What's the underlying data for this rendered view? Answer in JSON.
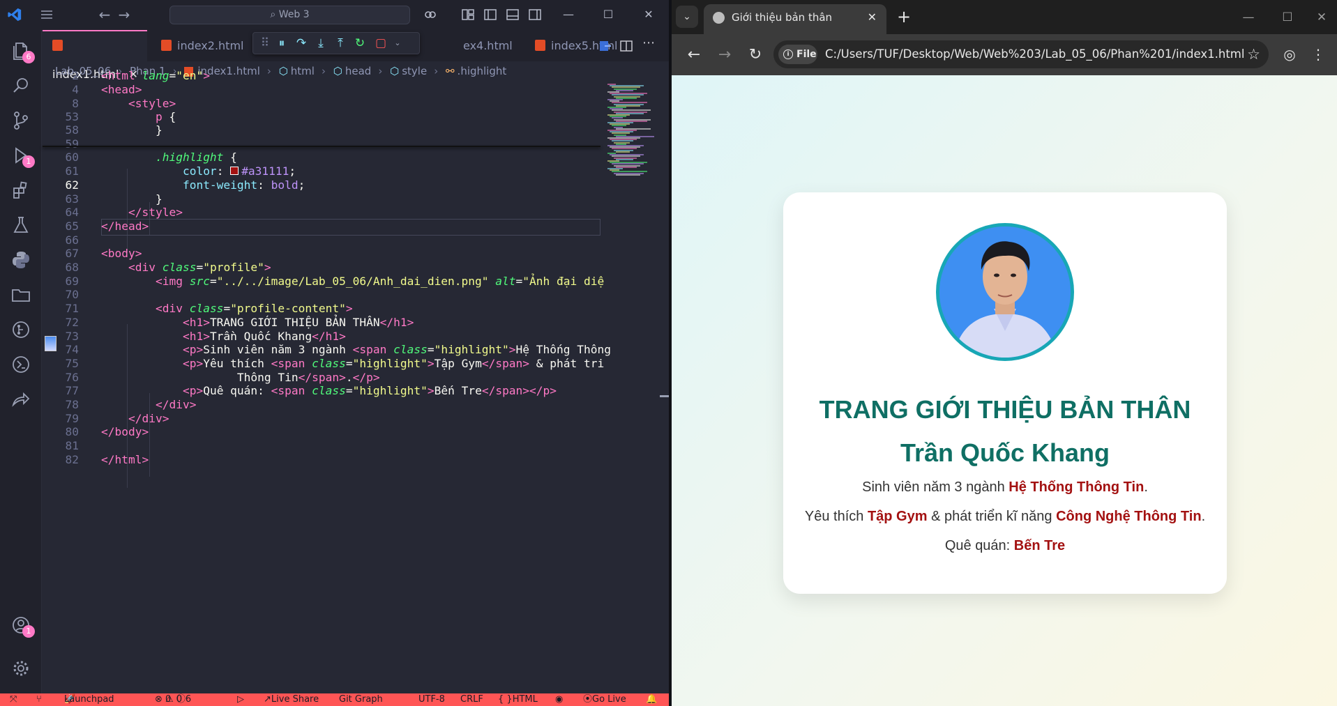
{
  "vscode": {
    "search_text": "Web 3",
    "tabs": [
      {
        "label": "index1.html",
        "active": true
      },
      {
        "label": "index2.html"
      },
      {
        "label": "ex4.html"
      },
      {
        "label": "index5.html"
      }
    ],
    "breadcrumb": [
      "Lab_05_06",
      "Phan 1",
      "index1.html",
      "html",
      "head",
      "style",
      ".highlight"
    ],
    "activity_badges": {
      "explorer": "6",
      "debug": "1",
      "account": "1"
    },
    "lines": [
      {
        "n": "2",
        "parts": [
          [
            "tagc",
            "<html "
          ],
          [
            "attr",
            "lang"
          ],
          [
            "pun",
            "="
          ],
          [
            "str",
            "\"en\""
          ],
          [
            "tagc",
            ">"
          ]
        ]
      },
      {
        "n": "4",
        "parts": [
          [
            "tagc",
            "<head>"
          ]
        ]
      },
      {
        "n": "8",
        "parts": [
          [
            "pun",
            "    "
          ],
          [
            "tagc",
            "<style>"
          ]
        ]
      },
      {
        "n": "53",
        "parts": [
          [
            "pun",
            "        "
          ],
          [
            "tagc",
            "p"
          ],
          [
            "pun",
            " {"
          ]
        ]
      },
      {
        "n": "58",
        "parts": [
          [
            "pun",
            "        }"
          ]
        ]
      },
      {
        "n": "59",
        "parts": [
          [
            "pun",
            ""
          ]
        ]
      },
      {
        "n": "60",
        "parts": [
          [
            "pun",
            "        "
          ],
          [
            "sel",
            ".highlight"
          ],
          [
            "pun",
            " {"
          ]
        ]
      },
      {
        "n": "61",
        "parts": [
          [
            "pun",
            "            "
          ],
          [
            "prop",
            "color"
          ],
          [
            "pun",
            ": "
          ],
          [
            "swatch",
            ""
          ],
          [
            "val",
            "#a31111"
          ],
          [
            "pun",
            ";"
          ]
        ]
      },
      {
        "n": "62",
        "parts": [
          [
            "pun",
            "            "
          ],
          [
            "prop",
            "font-weight"
          ],
          [
            "pun",
            ": "
          ],
          [
            "val",
            "bold"
          ],
          [
            "pun",
            ";"
          ]
        ]
      },
      {
        "n": "63",
        "parts": [
          [
            "pun",
            "        }"
          ]
        ]
      },
      {
        "n": "64",
        "parts": [
          [
            "pun",
            "    "
          ],
          [
            "tagc",
            "</style>"
          ]
        ]
      },
      {
        "n": "65",
        "parts": [
          [
            "tagc",
            "</head>"
          ]
        ]
      },
      {
        "n": "66",
        "parts": [
          [
            "pun",
            ""
          ]
        ]
      },
      {
        "n": "67",
        "parts": [
          [
            "tagc",
            "<body>"
          ]
        ]
      },
      {
        "n": "68",
        "parts": [
          [
            "pun",
            "    "
          ],
          [
            "tagc",
            "<div "
          ],
          [
            "attr",
            "class"
          ],
          [
            "pun",
            "="
          ],
          [
            "str",
            "\"profile\""
          ],
          [
            "tagc",
            ">"
          ]
        ]
      },
      {
        "n": "69",
        "parts": [
          [
            "pun",
            "        "
          ],
          [
            "tagc",
            "<img "
          ],
          [
            "attr",
            "src"
          ],
          [
            "pun",
            "="
          ],
          [
            "str",
            "\"../../image/Lab_05_06/Anh_dai_dien.png\""
          ],
          [
            "pun",
            " "
          ],
          [
            "attr",
            "alt"
          ],
          [
            "pun",
            "="
          ],
          [
            "str",
            "\"Ảnh đại diệ"
          ]
        ]
      },
      {
        "n": "70",
        "parts": [
          [
            "pun",
            ""
          ]
        ]
      },
      {
        "n": "71",
        "parts": [
          [
            "pun",
            "        "
          ],
          [
            "tagc",
            "<div "
          ],
          [
            "attr",
            "class"
          ],
          [
            "pun",
            "="
          ],
          [
            "str",
            "\"profile-content\""
          ],
          [
            "tagc",
            ">"
          ]
        ]
      },
      {
        "n": "72",
        "parts": [
          [
            "pun",
            "            "
          ],
          [
            "tagc",
            "<h1>"
          ],
          [
            "pun",
            "TRANG GIỚI THIỆU BẢN THÂN"
          ],
          [
            "tagc",
            "</h1>"
          ]
        ]
      },
      {
        "n": "73",
        "parts": [
          [
            "pun",
            "            "
          ],
          [
            "tagc",
            "<h1>"
          ],
          [
            "pun",
            "Trần Quốc Khang"
          ],
          [
            "tagc",
            "</h1>"
          ]
        ]
      },
      {
        "n": "74",
        "parts": [
          [
            "pun",
            "            "
          ],
          [
            "tagc",
            "<p>"
          ],
          [
            "pun",
            "Sinh viên năm 3 ngành "
          ],
          [
            "tagc",
            "<span "
          ],
          [
            "attr",
            "class"
          ],
          [
            "pun",
            "="
          ],
          [
            "str",
            "\"highlight\""
          ],
          [
            "tagc",
            ">"
          ],
          [
            "pun",
            "Hệ Thống Thông"
          ]
        ]
      },
      {
        "n": "75",
        "parts": [
          [
            "pun",
            "            "
          ],
          [
            "tagc",
            "<p>"
          ],
          [
            "pun",
            "Yêu thích "
          ],
          [
            "tagc",
            "<span "
          ],
          [
            "attr",
            "class"
          ],
          [
            "pun",
            "="
          ],
          [
            "str",
            "\"highlight\""
          ],
          [
            "tagc",
            ">"
          ],
          [
            "pun",
            "Tập Gym"
          ],
          [
            "tagc",
            "</span>"
          ],
          [
            "pun",
            " & phát tri"
          ]
        ]
      },
      {
        "n": "76",
        "parts": [
          [
            "pun",
            "                    Thông Tin"
          ],
          [
            "tagc",
            "</span>"
          ],
          [
            "pun",
            "."
          ],
          [
            "tagc",
            "</p>"
          ]
        ]
      },
      {
        "n": "77",
        "parts": [
          [
            "pun",
            "            "
          ],
          [
            "tagc",
            "<p>"
          ],
          [
            "pun",
            "Quê quán: "
          ],
          [
            "tagc",
            "<span "
          ],
          [
            "attr",
            "class"
          ],
          [
            "pun",
            "="
          ],
          [
            "str",
            "\"highlight\""
          ],
          [
            "tagc",
            ">"
          ],
          [
            "pun",
            "Bến Tre"
          ],
          [
            "tagc",
            "</span></p>"
          ]
        ]
      },
      {
        "n": "78",
        "parts": [
          [
            "pun",
            "        "
          ],
          [
            "tagc",
            "</div>"
          ]
        ]
      },
      {
        "n": "79",
        "parts": [
          [
            "pun",
            "    "
          ],
          [
            "tagc",
            "</div>"
          ]
        ]
      },
      {
        "n": "80",
        "parts": [
          [
            "tagc",
            "</body>"
          ]
        ]
      },
      {
        "n": "81",
        "parts": [
          [
            "pun",
            ""
          ]
        ]
      },
      {
        "n": "82",
        "parts": [
          [
            "tagc",
            "</html>"
          ]
        ]
      }
    ],
    "current_line": "62",
    "status": {
      "launchpad": "Launchpad",
      "errors": "0",
      "warnings": "0",
      "info": "6",
      "live_share": "Live Share",
      "git_graph": "Git Graph",
      "encoding": "UTF-8",
      "eol": "CRLF",
      "language": "HTML",
      "go_live": "Go Live"
    }
  },
  "chrome": {
    "tab_title": "Giới thiệu bản thân",
    "site_chip": "File",
    "url": "C:/Users/TUF/Desktop/Web/Web%203/Lab_05_06/Phan%201/index1.html",
    "page": {
      "title": "TRANG GIỚI THIỆU BẢN THÂN",
      "name": "Trần Quốc Khang",
      "p1_prefix": "Sinh viên năm 3 ngành ",
      "p1_hl": "Hệ Thống Thông Tin",
      "p1_suffix": ".",
      "p2_prefix": "Yêu thích ",
      "p2_hl1": "Tập Gym",
      "p2_mid": " & phát triển kĩ năng ",
      "p2_hl2": "Công Nghệ Thông Tin",
      "p2_suffix": ".",
      "p3_prefix": "Quê quán: ",
      "p3_hl": "Bến Tre"
    }
  },
  "colors": {
    "highlight": "#a31111",
    "heading": "#0f6f64",
    "avatar_border": "#18a7b5",
    "vscode_status": "#ff5555",
    "dracula_pink": "#ff79c6"
  }
}
